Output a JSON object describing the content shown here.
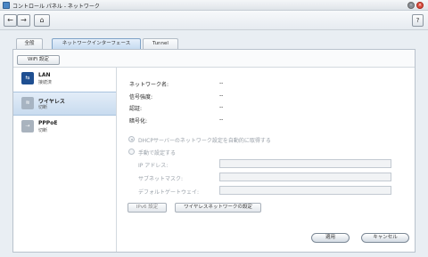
{
  "window": {
    "title": "コントロール パネル - ネットワーク",
    "minimize_glyph": "–",
    "close_glyph": "×"
  },
  "toolbar": {
    "back_glyph": "←",
    "forward_glyph": "→",
    "home_glyph": "⌂",
    "help_glyph": "?"
  },
  "tabs": [
    {
      "label": "全般"
    },
    {
      "label": "ネットワークインターフェース",
      "active": true
    },
    {
      "label": "Tunnel"
    }
  ],
  "wifi_settings_button": "WiFi 設定",
  "sidebar": {
    "items": [
      {
        "name": "LAN",
        "status": "接続済",
        "icon": "lan-icon",
        "icon_glyph": "⇆"
      },
      {
        "name": "ワイヤレス",
        "status": "切断",
        "icon": "wifi-icon",
        "icon_glyph": "≋",
        "selected": true
      },
      {
        "name": "PPPoE",
        "status": "切断",
        "icon": "pppoe-icon",
        "icon_glyph": "⇢"
      }
    ]
  },
  "info": [
    {
      "label": "ネットワーク名:",
      "value": "--"
    },
    {
      "label": "信号強度:",
      "value": "--"
    },
    {
      "label": "認証:",
      "value": "--"
    },
    {
      "label": "暗号化:",
      "value": "--"
    }
  ],
  "radios": {
    "dhcp_label": "DHCPサーバーのネットワーク設定を自動的に取得する",
    "manual_label": "手動で設定する"
  },
  "fields": {
    "ip_label": "IP アドレス:",
    "subnet_label": "サブネットマスク:",
    "gateway_label": "デフォルトゲートウェイ:"
  },
  "buttons": {
    "ipv6": "IPv6 設定",
    "wireless_settings": "ワイヤレスネットワークの設定",
    "apply": "適用",
    "cancel": "キャンセル"
  }
}
